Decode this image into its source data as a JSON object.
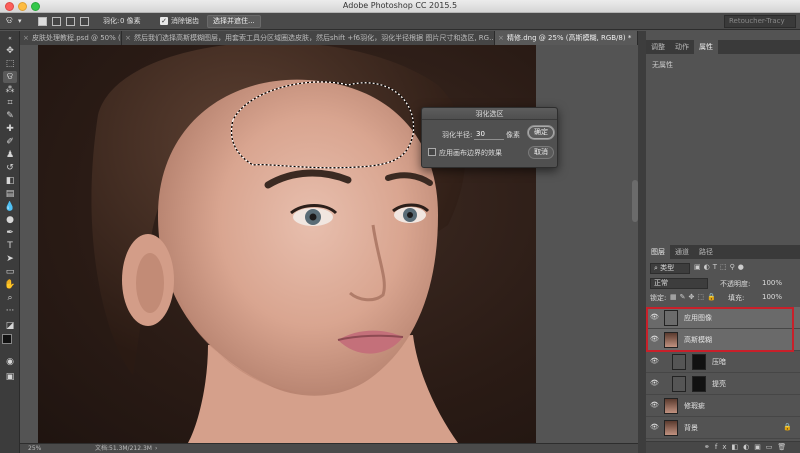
{
  "titlebar": {
    "title": "Adobe Photoshop CC 2015.5"
  },
  "options": {
    "feather_label": "羽化:",
    "feather_value": "0 像素",
    "antialias_label": "消除锯齿",
    "select_mask_button": "选择并遮住...",
    "workspace": "Retoucher-Tracy"
  },
  "tabs": [
    {
      "label": "皮肤处理教程.psd @ 50% ("
    },
    {
      "label": "然后我们选择高斯模糊图层，用套索工具分区域圈选皮肤，然后shift +f6羽化，羽化半径根据 图片尺寸和选区, RG..."
    },
    {
      "label": "精修.dng @ 25% (高斯模糊, RGB/8) *"
    }
  ],
  "statusbar": {
    "zoom": "25%",
    "doc": "文档:51.3M/212.3M"
  },
  "dialog": {
    "title": "羽化选区",
    "radius_label": "羽化半径:",
    "radius_value": "30",
    "unit": "像素",
    "ok": "确定",
    "cancel": "取消",
    "canvas_bounds_label": "应用画布边界的效果"
  },
  "props_panel": {
    "tabs": [
      "调整",
      "动作",
      "属性"
    ],
    "no_props": "无属性"
  },
  "layers_panel": {
    "tabs": [
      "图层",
      "通道",
      "路径"
    ],
    "kind_label": "类型",
    "blend_mode": "正常",
    "opacity_label": "不透明度:",
    "opacity_value": "100%",
    "lock_label": "锁定:",
    "fill_label": "填充:",
    "fill_value": "100%",
    "layers": [
      {
        "name": "应用图像"
      },
      {
        "name": "高斯模糊"
      },
      {
        "name": "压暗"
      },
      {
        "name": "提亮"
      },
      {
        "name": "修瑕疵"
      },
      {
        "name": "背景"
      }
    ]
  },
  "colors": {
    "selection_highlight": "#c8202a",
    "panel_bg": "#535353",
    "dark_bg": "#3c3c3c"
  }
}
